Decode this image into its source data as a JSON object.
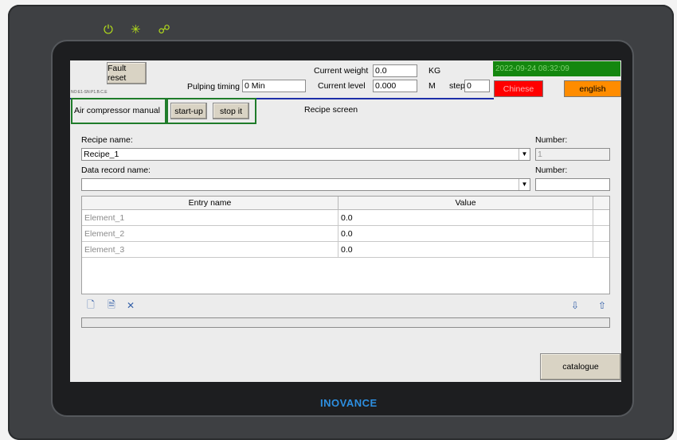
{
  "header": {
    "fault_reset": "Fault reset",
    "tiny_label": "NO:E1-SN:P1.B.C.E",
    "pulping_timing_label": "Pulping timing",
    "pulping_timing_value": "0  Min",
    "current_weight_label": "Current weight",
    "current_weight_value": "0.0",
    "weight_unit": "KG",
    "current_level_label": "Current level",
    "current_level_value": "0.000",
    "level_unit": "M",
    "step_label": "step",
    "step_value": "0",
    "datetime": "2022-09-24 08:32:09",
    "chinese_label": "Chinese",
    "english_label": "english"
  },
  "compressor": {
    "label": "Air compressor manual",
    "startup_label": "start-up",
    "stop_label": "stop it"
  },
  "screen_title": "Recipe screen",
  "recipe": {
    "name_label": "Recipe name:",
    "name_value": "Recipe_1",
    "number_label": "Number:",
    "number_value": "1",
    "record_label": "Data record name:",
    "record_value": "",
    "record_number_label": "Number:",
    "record_number_value": ""
  },
  "table": {
    "columns": [
      "Entry name",
      "Value"
    ],
    "rows": [
      {
        "name": "Element_1",
        "value": "0.0"
      },
      {
        "name": "Element_2",
        "value": "0.0"
      },
      {
        "name": "Element_3",
        "value": "0.0"
      }
    ]
  },
  "toolbar": {
    "icons": [
      "new-record-icon",
      "save-record-icon",
      "delete-record-icon",
      "import-icon",
      "export-icon"
    ]
  },
  "catalogue_label": "catalogue",
  "brand": "INOVANCE",
  "colors": {
    "date_bg": "#14870f",
    "chinese_bg": "#ff0000",
    "english_bg": "#ff8c00",
    "highlight_box": "#1f7c2a",
    "accent_line": "#1d2ea8",
    "status_icon": "#b7e21a"
  }
}
